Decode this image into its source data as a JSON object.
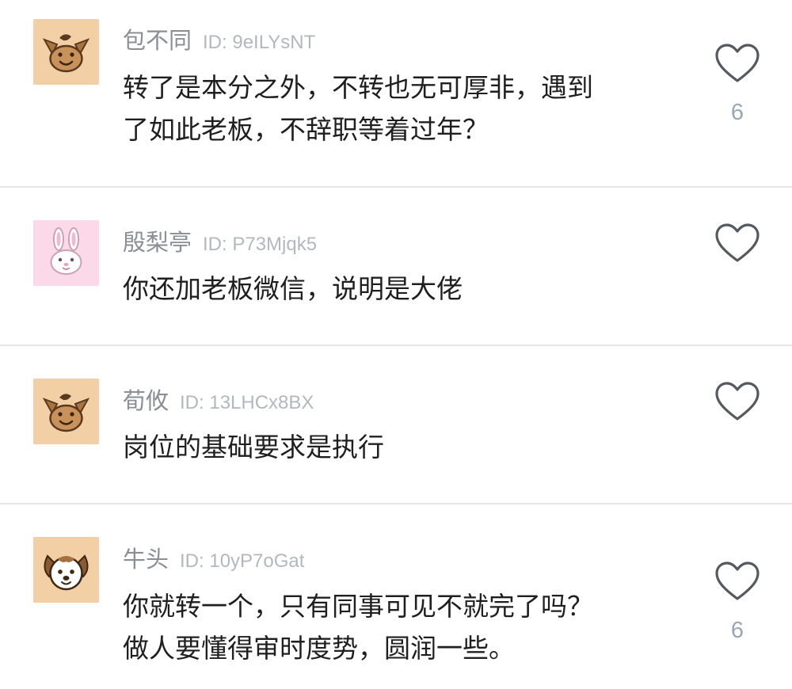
{
  "comments": [
    {
      "username": "包不同",
      "user_id": "ID: 9eILYsNT",
      "avatar": "cartoon-fox-icon",
      "avatar_bg": "#f3cfa5",
      "lines": [
        "转了是本分之外，不转也无可厚非，遇到",
        "了如此老板，不辞职等着过年？"
      ],
      "likes": "6"
    },
    {
      "username": "殷梨亭",
      "user_id": "ID: P73Mjqk5",
      "avatar": "cartoon-rabbit-icon",
      "avatar_bg": "#fcd9e8",
      "lines": [
        "你还加老板微信，说明是大佬"
      ],
      "likes": ""
    },
    {
      "username": "荀攸",
      "user_id": "ID: 13LHCx8BX",
      "avatar": "cartoon-fox-icon",
      "avatar_bg": "#f3cfa5",
      "lines": [
        "岗位的基础要求是执行"
      ],
      "likes": ""
    },
    {
      "username": "牛头",
      "user_id": "ID: 10yP7oGat",
      "avatar": "cartoon-dog-icon",
      "avatar_bg": "#f3cfa5",
      "lines": [
        "你就转一个，只有同事可见不就完了吗？",
        "做人要懂得审时度势，圆润一些。"
      ],
      "likes": "6"
    }
  ],
  "colors": {
    "username": "#8a8f96",
    "user_id": "#b3b8be",
    "text": "#1f1f1f",
    "like_icon": "#555a60",
    "like_count": "#9aa6b2",
    "divider": "#e6e6e6"
  }
}
